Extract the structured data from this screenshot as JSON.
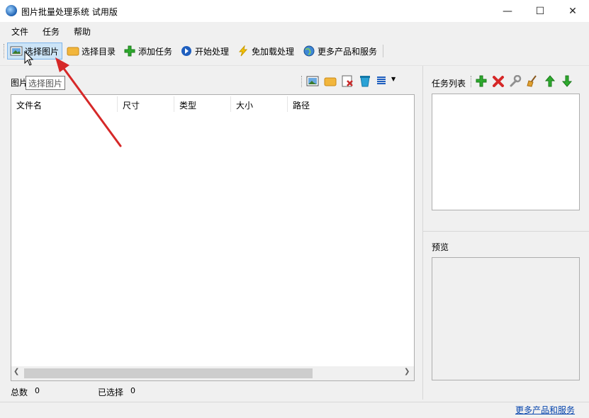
{
  "window": {
    "title": "图片批量处理系统 试用版",
    "controls": {
      "minimize": "—",
      "maximize": "☐",
      "close": "✕"
    }
  },
  "menu": [
    "文件",
    "任务",
    "帮助"
  ],
  "toolbar": {
    "select_image": "选择图片",
    "select_dir": "选择目录",
    "add_task": "添加任务",
    "start": "开始处理",
    "no_load": "免加载处理",
    "more": "更多产品和服务"
  },
  "tooltip": "选择图片",
  "image_panel": {
    "label": "图片",
    "columns": [
      "文件名",
      "尺寸",
      "类型",
      "大小",
      "路径"
    ]
  },
  "task_panel": {
    "label": "任务列表"
  },
  "preview_panel": {
    "label": "预览"
  },
  "footer": {
    "total_label": "总数",
    "total_value": "0",
    "selected_label": "已选择",
    "selected_value": "0",
    "more_link": "更多产品和服务"
  },
  "colors": {
    "accent": "#cce4f7",
    "link": "#0645ad",
    "arrow": "#d62828"
  }
}
